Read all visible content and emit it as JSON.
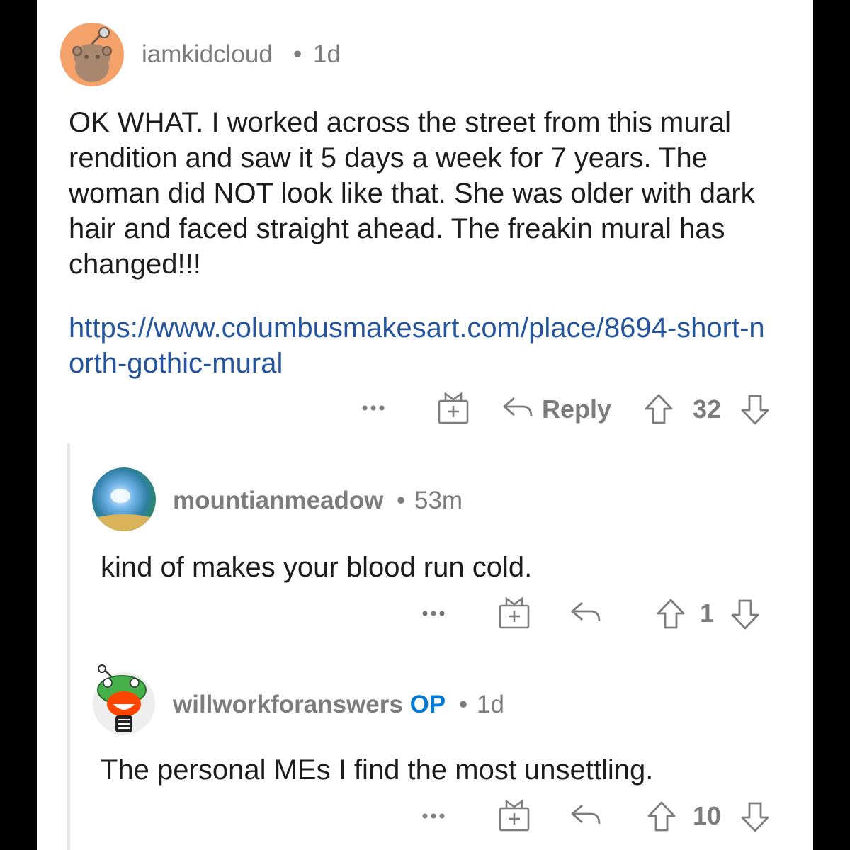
{
  "comments": [
    {
      "username": "iamkidcloud",
      "op_badge": "",
      "separator": "•",
      "time": "1d",
      "body": "OK WHAT. I worked across the street from this mural rendition and saw it 5 days a week for 7 years. The woman did NOT look like that. She was older with dark hair and faced straight ahead. The freakin mural has changed!!!",
      "link": "https://www.columbusmakesart.com/place/8694-short-north-gothic-mural",
      "reply_label": "Reply",
      "votes": "32",
      "avatar": "snoo-avatar-orange"
    },
    {
      "username": "mountianmeadow",
      "op_badge": "",
      "separator": "•",
      "time": "53m",
      "body": "kind of makes your blood run cold.",
      "votes": "1",
      "avatar": "wave-photo-avatar"
    },
    {
      "username": "willworkforanswers",
      "op_badge": "OP",
      "separator": "•",
      "time": "1d",
      "body": "The personal MEs I find the most unsettling.",
      "votes": "10",
      "avatar": "snoo-avatar-frog-hat"
    }
  ],
  "colors": {
    "username_gray": "#7c7c7c",
    "op_blue": "#0079d3",
    "link_blue": "#24559c",
    "body_text": "#1c1c1c"
  }
}
